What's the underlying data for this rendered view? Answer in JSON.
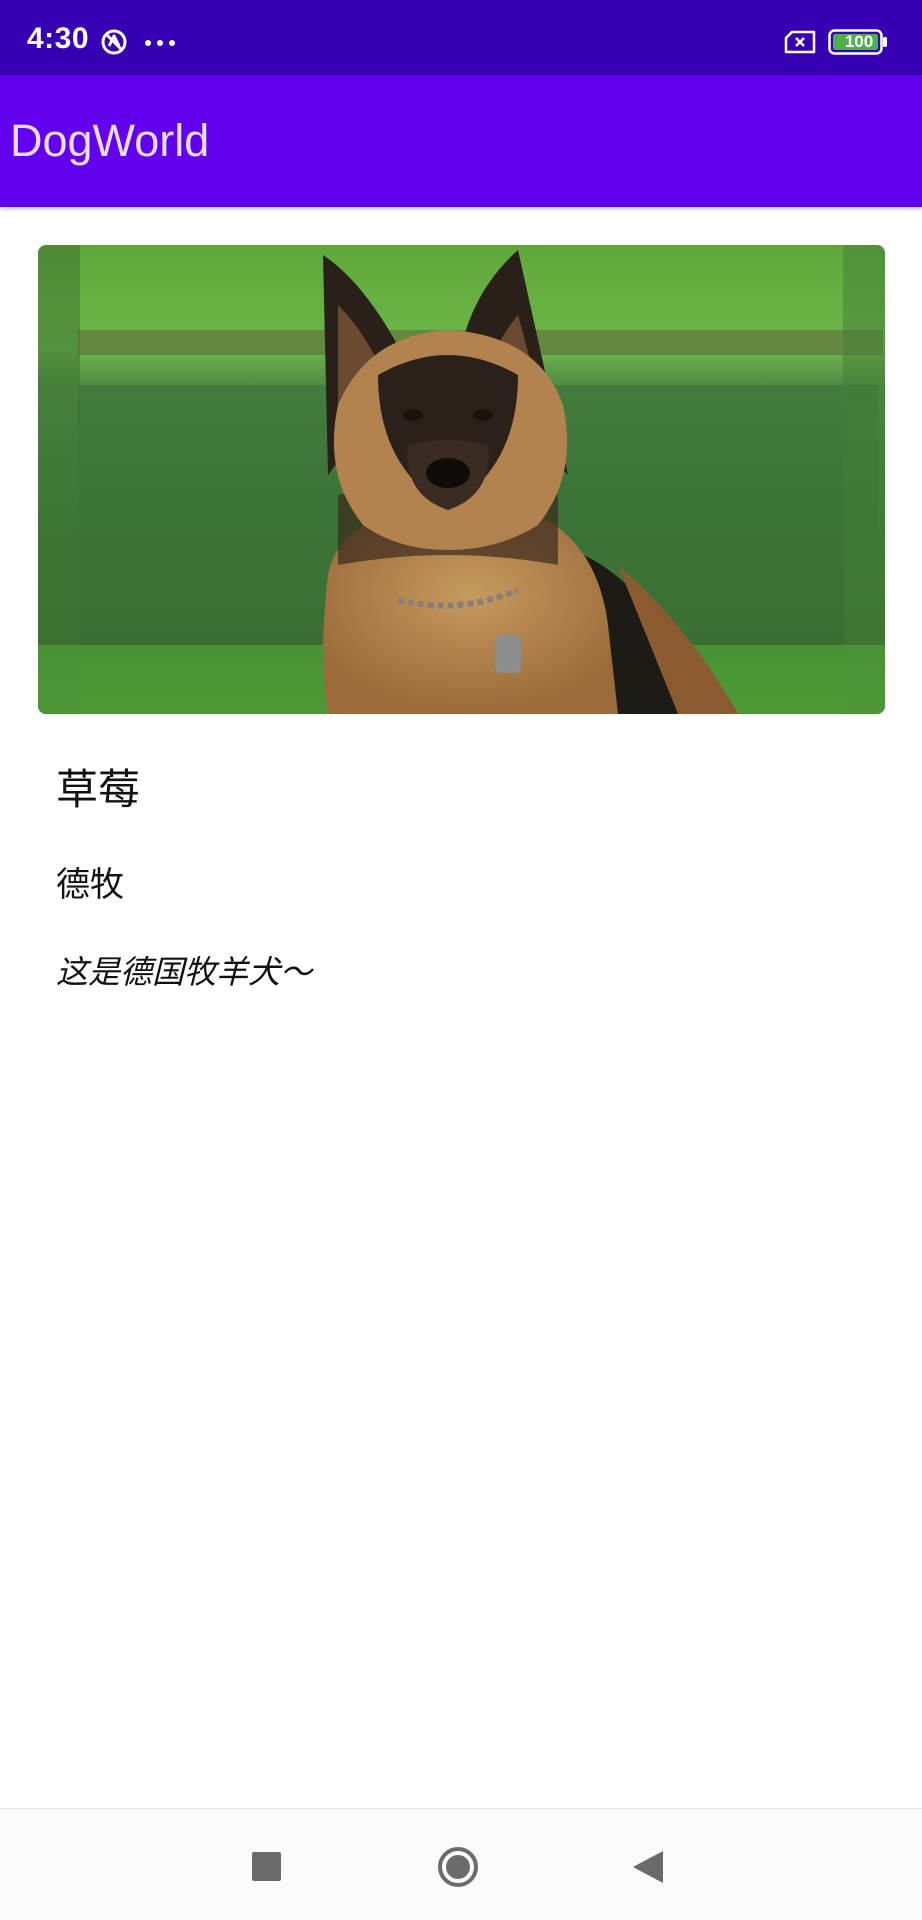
{
  "status_bar": {
    "time": "4:30",
    "battery": "100",
    "icons": [
      "sync-disabled-icon",
      "more-dots-icon",
      "sim-error-icon",
      "battery-icon"
    ]
  },
  "app_bar": {
    "title": "DogWorld"
  },
  "dog": {
    "image_name": "german-shepherd-photo",
    "name": "草莓",
    "breed": "德牧",
    "description": "这是德国牧羊犬～"
  },
  "nav_bar": {
    "buttons": [
      "recents-button",
      "home-button",
      "back-button"
    ]
  },
  "colors": {
    "status_bar": "#3700b3",
    "app_bar": "#6200ee",
    "title_text": "#e6dcfb",
    "background": "#ffffff"
  }
}
